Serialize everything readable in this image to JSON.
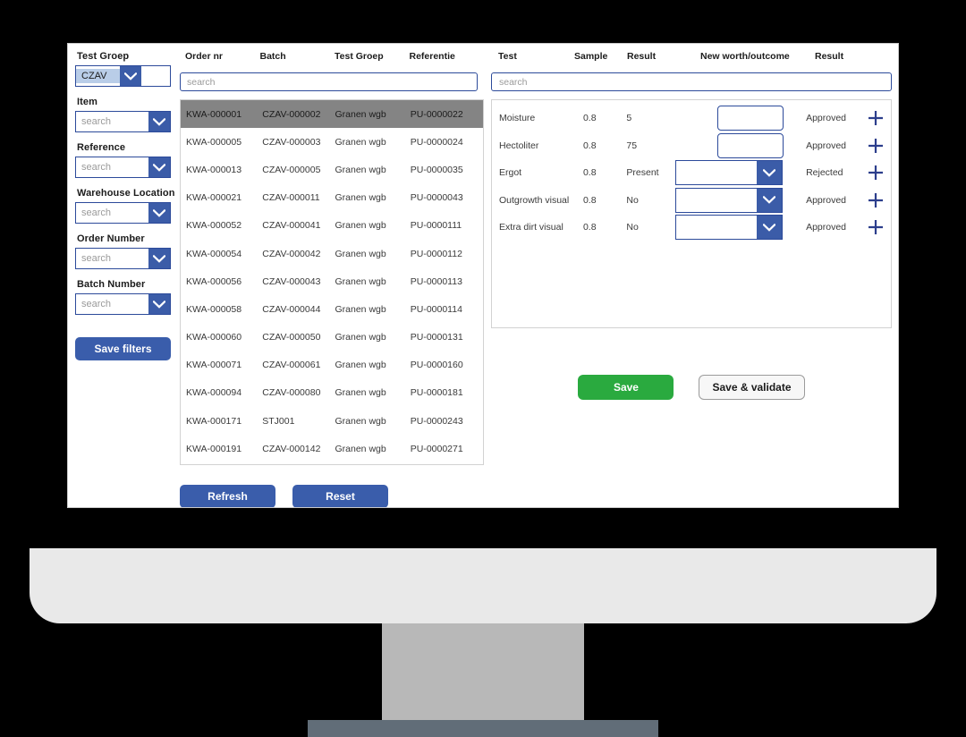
{
  "filters": {
    "groups": [
      {
        "label": "Test Groep",
        "value": "CZAV",
        "placeholder": "",
        "icon": "chevron-down-icon"
      },
      {
        "label": "Item",
        "value": "",
        "placeholder": "search",
        "icon": "chevron-down-icon"
      },
      {
        "label": "Reference",
        "value": "",
        "placeholder": "search",
        "icon": "chevron-down-icon"
      },
      {
        "label": "Warehouse Location",
        "value": "",
        "placeholder": "search",
        "icon": "chevron-down-icon"
      },
      {
        "label": "Order Number",
        "value": "",
        "placeholder": "search",
        "icon": "chevron-down-icon"
      },
      {
        "label": "Batch Number",
        "value": "",
        "placeholder": "search",
        "icon": "chevron-down-icon"
      }
    ],
    "save_filters_label": "Save filters"
  },
  "orders": {
    "headers": [
      "Order nr",
      "Batch",
      "Test Groep",
      "Referentie"
    ],
    "search_placeholder": "search",
    "rows": [
      {
        "order": "KWA-000001",
        "batch": "CZAV-000002",
        "groep": "Granen wgb",
        "ref": "PU-0000022",
        "selected": true
      },
      {
        "order": "KWA-000005",
        "batch": "CZAV-000003",
        "groep": "Granen wgb",
        "ref": "PU-0000024",
        "selected": false
      },
      {
        "order": "KWA-000013",
        "batch": "CZAV-000005",
        "groep": "Granen wgb",
        "ref": "PU-0000035",
        "selected": false
      },
      {
        "order": "KWA-000021",
        "batch": "CZAV-000011",
        "groep": "Granen wgb",
        "ref": "PU-0000043",
        "selected": false
      },
      {
        "order": "KWA-000052",
        "batch": "CZAV-000041",
        "groep": "Granen wgb",
        "ref": "PU-0000111",
        "selected": false
      },
      {
        "order": "KWA-000054",
        "batch": "CZAV-000042",
        "groep": "Granen wgb",
        "ref": "PU-0000112",
        "selected": false
      },
      {
        "order": "KWA-000056",
        "batch": "CZAV-000043",
        "groep": "Granen wgb",
        "ref": "PU-0000113",
        "selected": false
      },
      {
        "order": "KWA-000058",
        "batch": "CZAV-000044",
        "groep": "Granen wgb",
        "ref": "PU-0000114",
        "selected": false
      },
      {
        "order": "KWA-000060",
        "batch": "CZAV-000050",
        "groep": "Granen wgb",
        "ref": "PU-0000131",
        "selected": false
      },
      {
        "order": "KWA-000071",
        "batch": "CZAV-000061",
        "groep": "Granen wgb",
        "ref": "PU-0000160",
        "selected": false
      },
      {
        "order": "KWA-000094",
        "batch": "CZAV-000080",
        "groep": "Granen wgb",
        "ref": "PU-0000181",
        "selected": false
      },
      {
        "order": "KWA-000171",
        "batch": "STJ001",
        "groep": "Granen wgb",
        "ref": "PU-0000243",
        "selected": false
      },
      {
        "order": "KWA-000191",
        "batch": "CZAV-000142",
        "groep": "Granen wgb",
        "ref": "PU-0000271",
        "selected": false
      }
    ],
    "refresh_label": "Refresh",
    "reset_label": "Reset"
  },
  "tests": {
    "headers": [
      "Test",
      "Sample",
      "Result",
      "New worth/outcome",
      "Result"
    ],
    "search_placeholder": "search",
    "rows": [
      {
        "test": "Moisture",
        "sample": "0.8",
        "result": "5",
        "input_type": "text",
        "input_value": "",
        "outcome": "Approved",
        "add_icon": "plus-icon"
      },
      {
        "test": "Hectoliter",
        "sample": "0.8",
        "result": "75",
        "input_type": "text",
        "input_value": "",
        "outcome": "Approved",
        "add_icon": "plus-icon"
      },
      {
        "test": "Ergot",
        "sample": "0.8",
        "result": "Present",
        "input_type": "dropdown",
        "input_value": "",
        "outcome": "Rejected",
        "add_icon": "plus-icon"
      },
      {
        "test": "Outgrowth visual",
        "sample": "0.8",
        "result": "No",
        "input_type": "dropdown",
        "input_value": "",
        "outcome": "Approved",
        "add_icon": "plus-icon"
      },
      {
        "test": "Extra dirt visual",
        "sample": "0.8",
        "result": "No",
        "input_type": "dropdown",
        "input_value": "",
        "outcome": "Approved",
        "add_icon": "plus-icon"
      }
    ],
    "save_label": "Save",
    "save_validate_label": "Save & validate"
  },
  "colors": {
    "accent_blue": "#3a5dab",
    "border_blue": "#2c4a9a",
    "green": "#2aaa3f",
    "selected_row": "#848484",
    "bezel": "#e9e9e9",
    "stand": "#b8b8b8",
    "base": "#616d78"
  }
}
